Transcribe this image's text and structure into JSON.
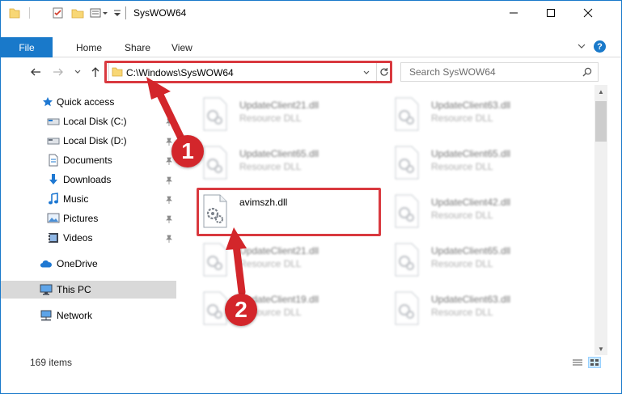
{
  "window": {
    "title": "SysWOW64"
  },
  "ribbon": {
    "tabs": [
      "File",
      "Home",
      "Share",
      "View"
    ],
    "help_label": "?"
  },
  "nav": {
    "address": "C:\\Windows\\SysWOW64",
    "search_placeholder": "Search SysWOW64"
  },
  "sidebar": {
    "items": [
      {
        "label": "Quick access",
        "icon": "star-icon"
      },
      {
        "label": "Local Disk (C:)",
        "icon": "drive-icon"
      },
      {
        "label": "Local Disk (D:)",
        "icon": "drive-icon"
      },
      {
        "label": "Documents",
        "icon": "documents-icon"
      },
      {
        "label": "Downloads",
        "icon": "download-arrow-icon"
      },
      {
        "label": "Music",
        "icon": "music-note-icon"
      },
      {
        "label": "Pictures",
        "icon": "pictures-icon"
      },
      {
        "label": "Videos",
        "icon": "videos-icon"
      },
      {
        "label": "OneDrive",
        "icon": "cloud-icon"
      },
      {
        "label": "This PC",
        "icon": "monitor-icon"
      },
      {
        "label": "Network",
        "icon": "network-icon"
      }
    ],
    "selected": "This PC"
  },
  "files": [
    {
      "name": "UpdateClient21.dll",
      "type": "Resource DLL",
      "blurred": true
    },
    {
      "name": "UpdateClient63.dll",
      "type": "Resource DLL",
      "blurred": true
    },
    {
      "name": "UpdateClient65.dll",
      "type": "Resource DLL",
      "blurred": true
    },
    {
      "name": "UpdateClient65.dll",
      "type": "Resource DLL",
      "blurred": true
    },
    {
      "name": "avimszh.dll",
      "type": "",
      "blurred": false
    },
    {
      "name": "UpdateClient42.dll",
      "type": "Resource DLL",
      "blurred": true
    },
    {
      "name": "UpdateClient21.dll",
      "type": "Resource DLL",
      "blurred": true
    },
    {
      "name": "UpdateClient65.dll",
      "type": "Resource DLL",
      "blurred": true
    },
    {
      "name": "UpdateClient19.dll",
      "type": "Resource DLL",
      "blurred": true
    },
    {
      "name": "UpdateClient63.dll",
      "type": "Resource DLL",
      "blurred": true
    }
  ],
  "status": {
    "items_count": "169 items"
  },
  "annotations": {
    "step1": "1",
    "step2": "2",
    "color": "#d3262b"
  },
  "colors": {
    "accent": "#1979ca",
    "selection": "#d9d9d9",
    "highlight": "#d9393f"
  }
}
